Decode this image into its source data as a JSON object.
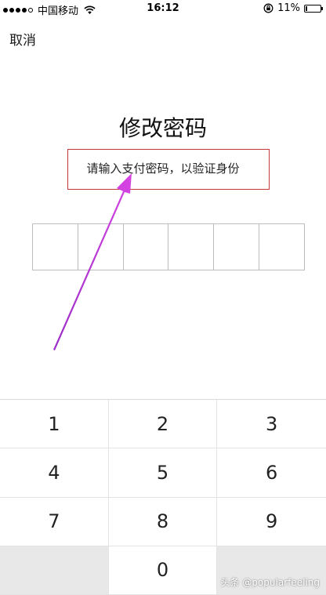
{
  "status_bar": {
    "carrier": "中国移动",
    "time": "16:12",
    "battery": "11%"
  },
  "nav": {
    "cancel_label": "取消"
  },
  "main": {
    "title": "修改密码",
    "subtitle": "请输入支付密码，以验证身份"
  },
  "keypad": {
    "keys": [
      "1",
      "2",
      "3",
      "4",
      "5",
      "6",
      "7",
      "8",
      "9",
      "",
      "0",
      ""
    ]
  },
  "watermark": "头条 @popularfeeling",
  "colors": {
    "highlight_box": "#c8373b",
    "arrow": "#c53ad8"
  }
}
